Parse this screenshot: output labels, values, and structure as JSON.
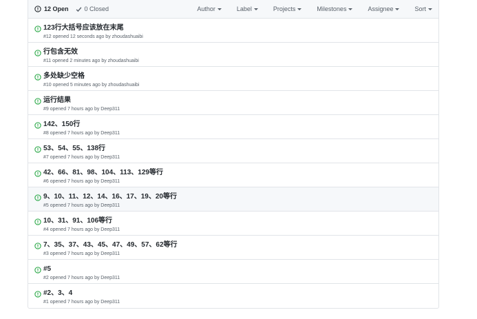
{
  "toolbar": {
    "open_label": "12 Open",
    "closed_label": "0 Closed",
    "filters": [
      "Author",
      "Label",
      "Projects",
      "Milestones",
      "Assignee",
      "Sort"
    ]
  },
  "colors": {
    "open_green": "#28a745",
    "border": "#e1e4e8",
    "header_bg": "#f6f8fa"
  },
  "issues": [
    {
      "title": "123行大括号应该放在末尾",
      "meta": "#12 opened 12 seconds ago by zhoudashuaibi"
    },
    {
      "title": "行包含无效",
      "meta": "#11 opened 2 minutes ago by zhoudashuaibi"
    },
    {
      "title": "多处缺少空格",
      "meta": "#10 opened 5 minutes ago by zhoudashuaibi"
    },
    {
      "title": "运行结果",
      "meta": "#9 opened 7 hours ago by Deep311"
    },
    {
      "title": "142、150行",
      "meta": "#8 opened 7 hours ago by Deep311"
    },
    {
      "title": "53、54、55、138行",
      "meta": "#7 opened 7 hours ago by Deep311"
    },
    {
      "title": "42、66、81、98、104、113、129等行",
      "meta": "#6 opened 7 hours ago by Deep311"
    },
    {
      "title": "9、10、11、12、14、16、17、19、20等行",
      "meta": "#5 opened 7 hours ago by Deep311"
    },
    {
      "title": "10、31、91、106等行",
      "meta": "#4 opened 7 hours ago by Deep311"
    },
    {
      "title": "7、35、37、43、45、47、49、57、62等行",
      "meta": "#3 opened 7 hours ago by Deep311"
    },
    {
      "title": "#5",
      "meta": "#2 opened 7 hours ago by Deep311"
    },
    {
      "title": "#2、3、4",
      "meta": "#1 opened 7 hours ago by Deep311"
    }
  ]
}
